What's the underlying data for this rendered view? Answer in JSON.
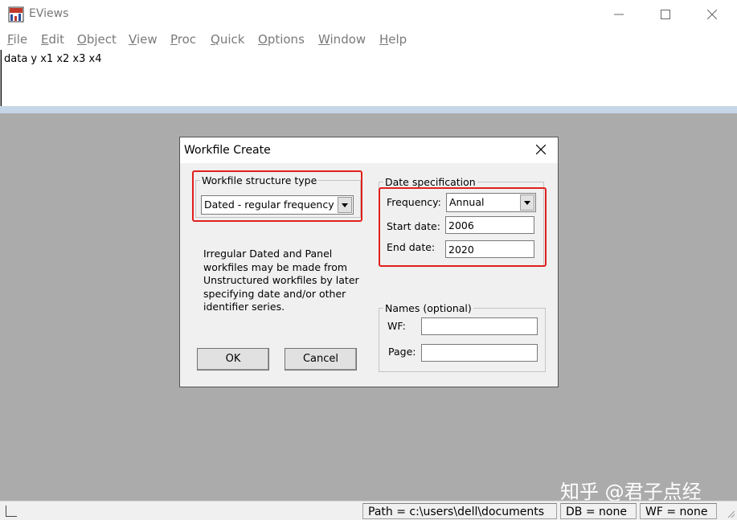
{
  "app": {
    "title": "EViews"
  },
  "menu": {
    "items": [
      "File",
      "Edit",
      "Object",
      "View",
      "Proc",
      "Quick",
      "Options",
      "Window",
      "Help"
    ]
  },
  "command": {
    "text": "data  y x1 x2 x3 x4"
  },
  "dialog": {
    "title": "Workfile Create",
    "structure": {
      "legend": "Workfile structure type",
      "value": "Dated - regular frequency"
    },
    "info": "Irregular Dated and Panel workfiles may be made from Unstructured workfiles by later specifying date and/or other identifier series.",
    "date_spec": {
      "legend": "Date specification",
      "frequency_label": "Frequency:",
      "frequency_value": "Annual",
      "start_label": "Start date:",
      "start_value": "2006",
      "end_label": "End date:",
      "end_value": "2020"
    },
    "names": {
      "legend": "Names (optional)",
      "wf_label": "WF:",
      "wf_value": "",
      "page_label": "Page:",
      "page_value": ""
    },
    "ok_label": "OK",
    "cancel_label": "Cancel"
  },
  "status": {
    "path": "Path = c:\\users\\dell\\documents",
    "db": "DB = none",
    "wf": "WF = none"
  },
  "watermark": "知乎 @君子点经",
  "colors": {
    "highlight": "#e0201e",
    "workspace": "#ababab"
  }
}
